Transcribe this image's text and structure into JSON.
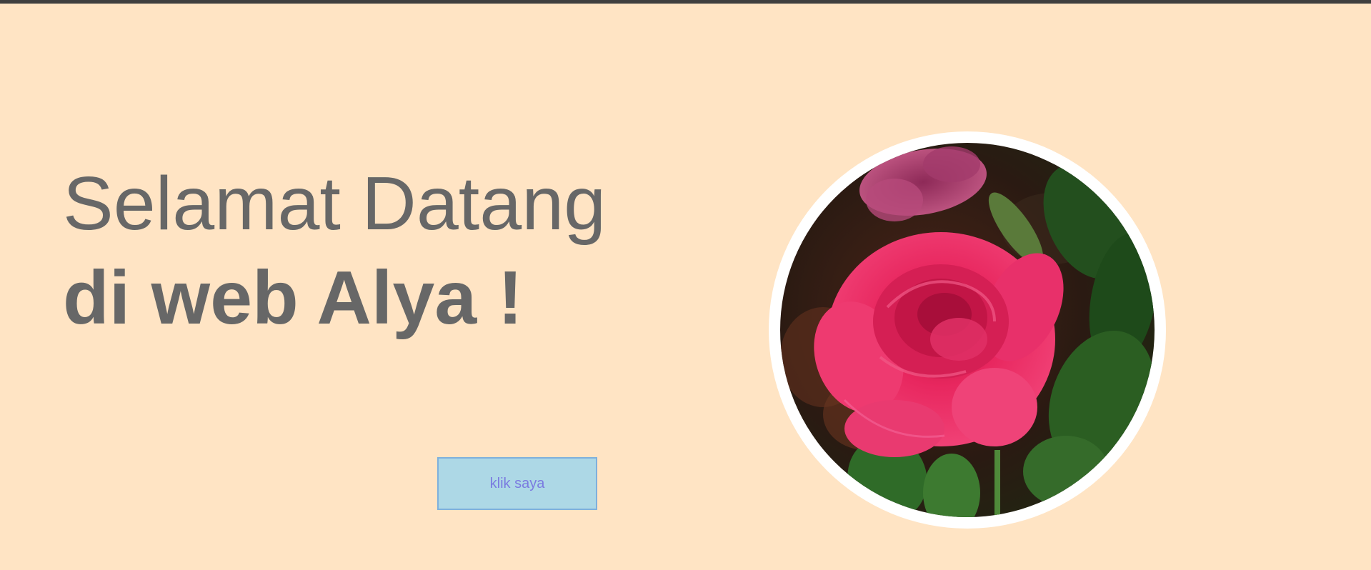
{
  "hero": {
    "line1": "Selamat Datang",
    "line2": "di web Alya !"
  },
  "button": {
    "label": "klik saya"
  },
  "image": {
    "subject": "pink rose photo",
    "icon": "rose-photo"
  },
  "colors": {
    "background": "#ffe4c4",
    "heading_text": "#676767",
    "button_bg": "#add8e6",
    "button_border": "#7fb0dc",
    "button_text": "#7b7be0",
    "top_border": "#3f3f3f",
    "photo_frame": "#ffffff"
  }
}
